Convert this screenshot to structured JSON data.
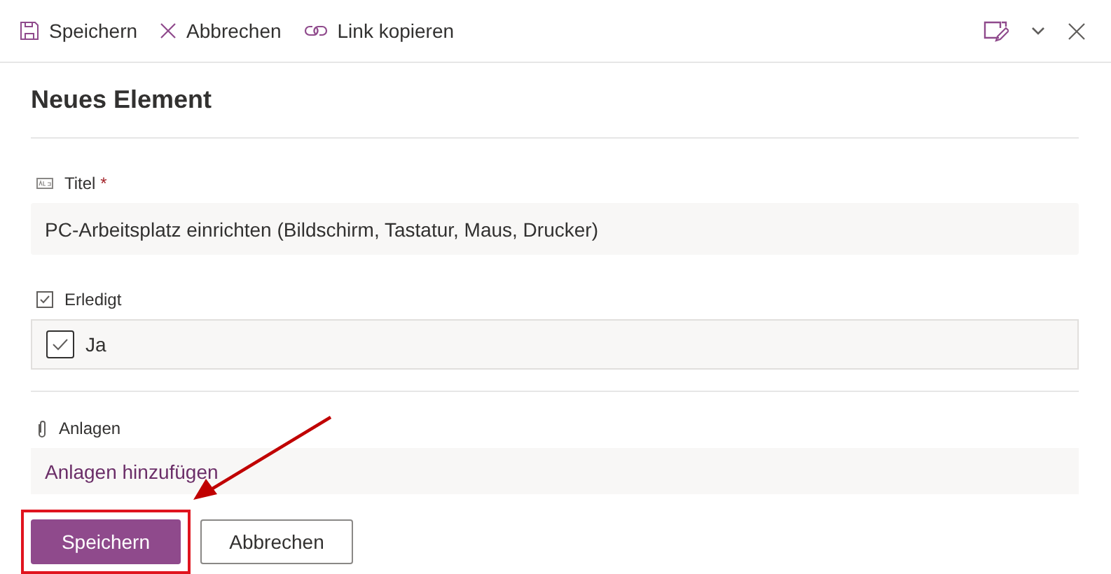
{
  "toolbar": {
    "commands": [
      {
        "kind": "save",
        "label": "Speichern"
      },
      {
        "kind": "cancel",
        "label": "Abbrechen"
      },
      {
        "kind": "link",
        "label": "Link kopieren"
      }
    ]
  },
  "form": {
    "title": "Neues Element",
    "fields": [
      {
        "kind": "text",
        "label": "Titel",
        "required_mark": "*",
        "value": "PC-Arbeitsplatz einrichten (Bildschirm, Tastatur, Maus, Drucker)"
      },
      {
        "kind": "checkbox",
        "label": "Erledigt",
        "checked": true,
        "option": "Ja"
      },
      {
        "kind": "attachments",
        "label": "Anlagen",
        "link": "Anlagen hinzufügen"
      }
    ],
    "buttons": [
      {
        "kind": "primary",
        "label": "Speichern",
        "highlighted": true
      },
      {
        "kind": "secondary",
        "label": "Abbrechen",
        "highlighted": false
      }
    ]
  }
}
